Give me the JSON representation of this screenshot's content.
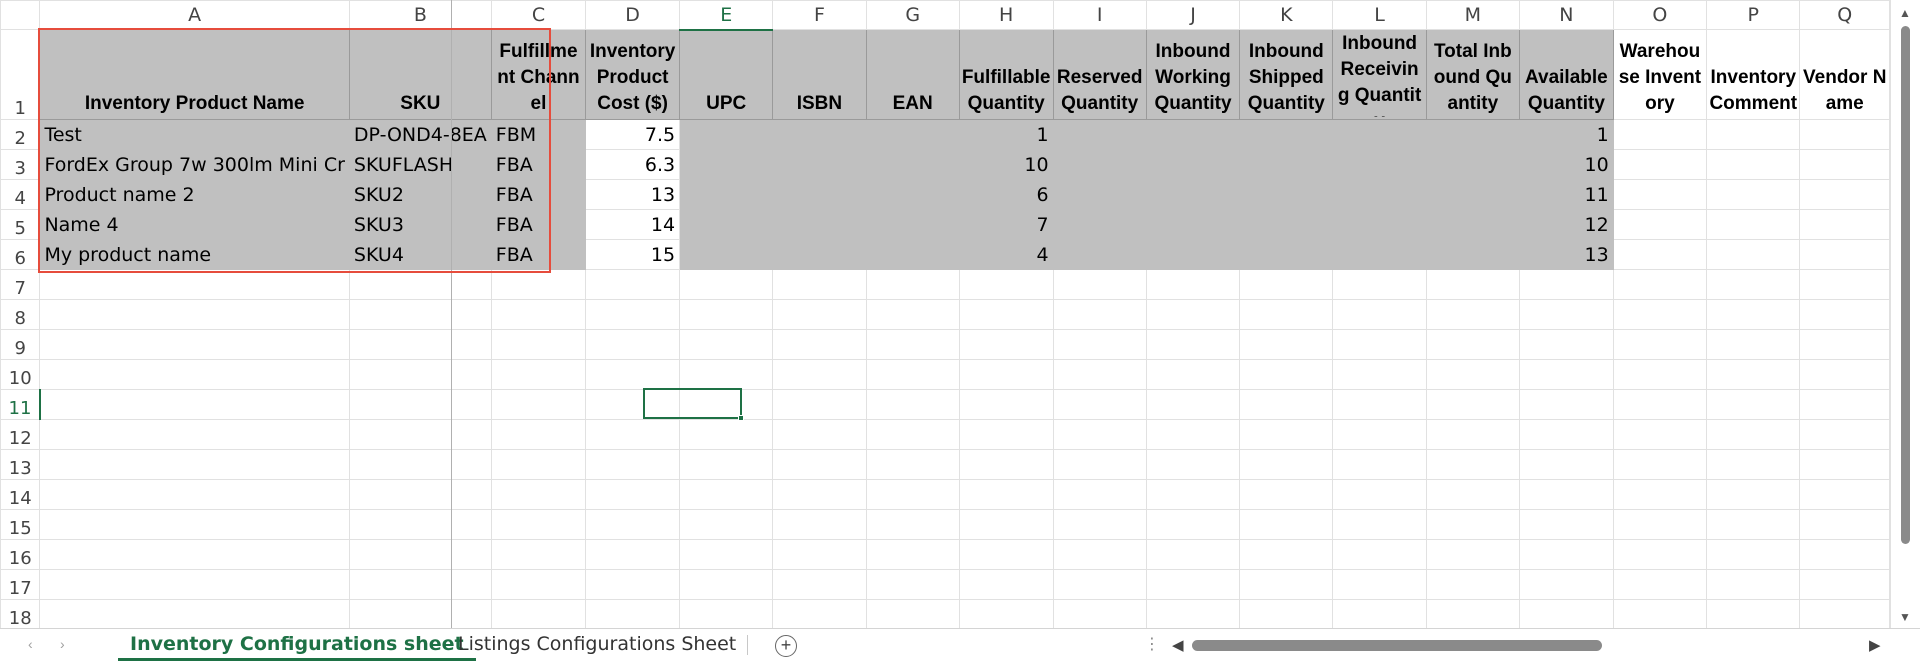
{
  "columns": [
    "A",
    "B",
    "C",
    "D",
    "E",
    "F",
    "G",
    "H",
    "I",
    "J",
    "K",
    "L",
    "M",
    "N",
    "O",
    "P",
    "Q"
  ],
  "selected_column": "E",
  "selected_row": "11",
  "header_row": {
    "row_number": "1",
    "cells": [
      "Inventory Product Name",
      "SKU",
      "Fulfillment Channel",
      "Inventory Product Cost ($)",
      "UPC",
      "ISBN",
      "EAN",
      "Fulfillable Quantity",
      "Reserved Quantity",
      "Inbound Working Quantity",
      "Inbound Shipped Quantity",
      "Inbound Receiving Quantity",
      "Total Inbound Quantity",
      "Available Quantity",
      "Warehouse Inventory",
      "Inventory Comment",
      "Vendor Name"
    ]
  },
  "data_rows": [
    {
      "row_number": "2",
      "product_name": "Test",
      "sku": "DP-OND4-8EA",
      "channel": "FBM",
      "cost": "7.5",
      "fulfillable": "1",
      "available": "1"
    },
    {
      "row_number": "3",
      "product_name": "FordEx Group 7w 300lm Mini Cr",
      "sku": "SKUFLASH",
      "channel": "FBA",
      "cost": "6.3",
      "fulfillable": "10",
      "available": "10"
    },
    {
      "row_number": "4",
      "product_name": "Product name 2",
      "sku": "SKU2",
      "channel": "FBA",
      "cost": "13",
      "fulfillable": "6",
      "available": "11"
    },
    {
      "row_number": "5",
      "product_name": "Name 4",
      "sku": "SKU3",
      "channel": "FBA",
      "cost": "14",
      "fulfillable": "7",
      "available": "12"
    },
    {
      "row_number": "6",
      "product_name": "My product name",
      "sku": "SKU4",
      "channel": "FBA",
      "cost": "15",
      "fulfillable": "4",
      "available": "13"
    }
  ],
  "empty_rows": [
    "7",
    "8",
    "9",
    "10",
    "11",
    "12",
    "13",
    "14",
    "15",
    "16",
    "17",
    "18"
  ],
  "sheet_tabs": [
    {
      "label": "Inventory Configurations sheet",
      "active": true
    },
    {
      "label": "Listings Configurations Sheet",
      "active": false
    }
  ],
  "icons": {
    "add_sheet": "plus-circle-icon",
    "nav_prev": "chevron-left-icon",
    "nav_next": "chevron-right-icon",
    "scroll_left": "triangle-left-icon",
    "scroll_right": "triangle-right-icon",
    "scroll_up": "triangle-up-icon",
    "scroll_down": "triangle-down-icon",
    "more": "vertical-dots-icon"
  },
  "colors": {
    "accent": "#1e7145",
    "header_fill": "#c0c0c0",
    "highlight_border": "#e64c3c"
  }
}
